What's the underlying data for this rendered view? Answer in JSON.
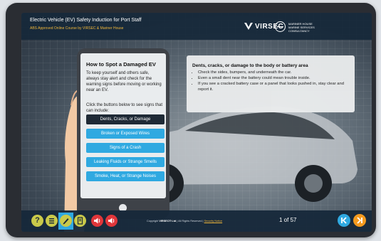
{
  "header": {
    "title": "Electric Vehicle (EV) Safety Induction for Port Staff",
    "subtitle": "ABS Approved Online Course by VIRSEC & Mariner House",
    "brand": "VIRSEC",
    "partner": [
      "MARINER HOUSE",
      "MARINE SERVICES",
      "CONSULTANCY"
    ]
  },
  "card": {
    "title": "How to Spot a Damaged EV",
    "intro": "To keep yourself and others safe, always stay alert and check for the warning signs before moving or working near an EV.",
    "prompt": "Click the buttons below to see signs that can include:",
    "buttons": [
      "Dents, Cracks, or Damage",
      "Broken or Exposed Wires",
      "Signs of a Crash",
      "Leaking Fluids or Strange Smells",
      "Smoke, Heat, or Strange Noises"
    ]
  },
  "info": {
    "heading": "Dents, cracks, or damage to the body or battery area",
    "bullets": [
      "Check the sides, bumpers, and underneath the car.",
      "Even a small dent near the battery could mean trouble inside.",
      "If you see a cracked battery case or a panel that looks pushed in, stay clear and report it."
    ]
  },
  "footer": {
    "help": "?",
    "copyright_prefix": "Copyright",
    "company": "VIRSEC® Ltd",
    "rights": "| All Rights Reserved |",
    "security": "Security Notice",
    "page": "1 of 57",
    "back": "K",
    "next": "K"
  },
  "colors": {
    "accent_blue": "#2fa9e1",
    "accent_yellow": "#c9c94a",
    "accent_red": "#e0363a",
    "accent_orange": "#f39a1f",
    "header_bg": "#16283a"
  }
}
